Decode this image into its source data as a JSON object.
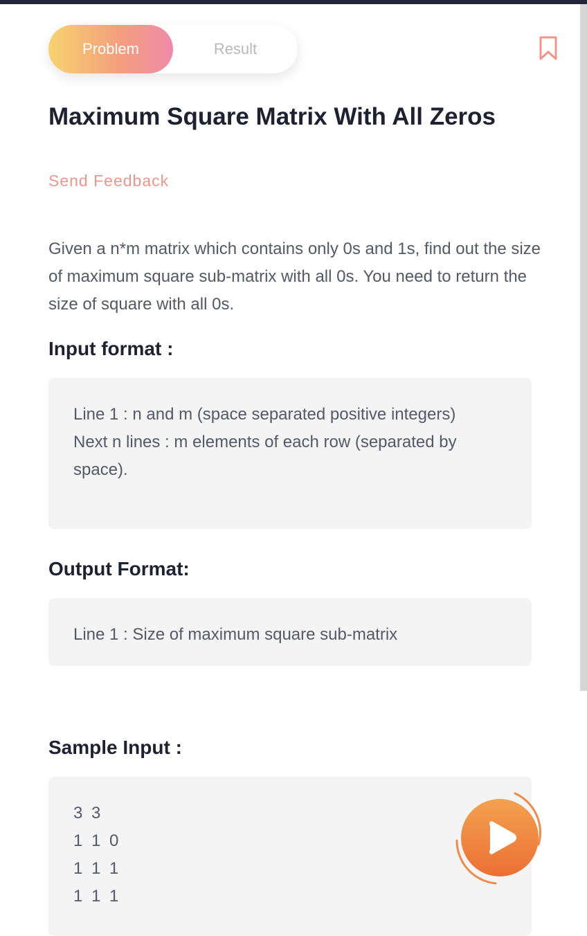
{
  "tabs": {
    "problem_label": "Problem",
    "result_label": "Result"
  },
  "problem": {
    "title": "Maximum Square Matrix With All Zeros",
    "feedback_label": "Send Feedback",
    "description": "Given a n*m matrix which contains only 0s and 1s, find out the size of maximum square sub-matrix with all 0s. You need to return the size of square with all 0s."
  },
  "input_format": {
    "heading": "Input format :",
    "lines": [
      "Line 1 : n and m (space separated positive integers)",
      "Next n lines : m elements of each row (separated by space)."
    ]
  },
  "output_format": {
    "heading": "Output Format:",
    "lines": [
      "Line 1 : Size of maximum square sub-matrix"
    ]
  },
  "sample_input": {
    "heading": "Sample Input :",
    "lines": [
      "3 3",
      "1 1 0",
      "1 1 1",
      "1 1 1"
    ]
  },
  "icons": {
    "bookmark": "bookmark-icon",
    "run": "play-icon"
  },
  "colors": {
    "accent": "#f0958d",
    "tab_gradient_start": "#f6d36f",
    "tab_gradient_end": "#f08aa8",
    "fab": "#ee7d3e"
  }
}
